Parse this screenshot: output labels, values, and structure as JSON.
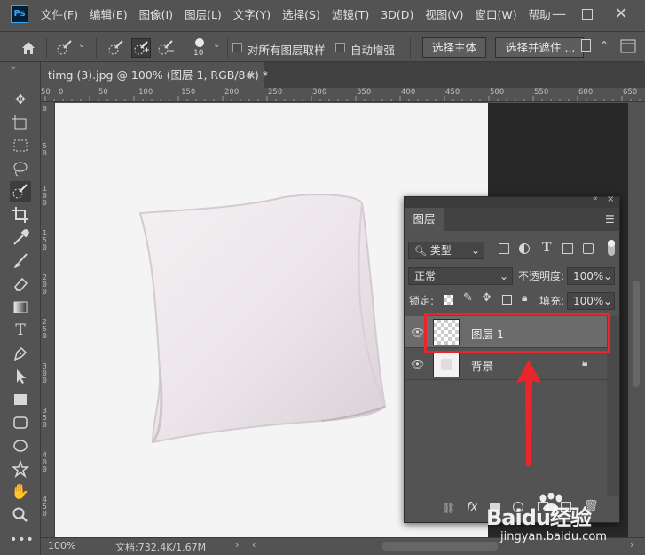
{
  "app": {
    "logo": "Ps"
  },
  "menu": [
    "文件(F)",
    "编辑(E)",
    "图像(I)",
    "图层(L)",
    "文字(Y)",
    "选择(S)",
    "滤镜(T)",
    "3D(D)",
    "视图(V)",
    "窗口(W)",
    "帮助"
  ],
  "options_bar": {
    "brush_size": "10",
    "sample_all_layers_label": "对所有图层取样",
    "auto_enhance_label": "自动增强",
    "select_subject_label": "选择主体",
    "select_and_mask_label": "选择并遮住 ..."
  },
  "document": {
    "tab_title": "timg (3).jpg @ 100% (图层 1, RGB/8#) *"
  },
  "ruler_top": [
    "50",
    "0",
    "50",
    "100",
    "150",
    "200",
    "250",
    "300",
    "350",
    "400",
    "450",
    "500",
    "550",
    "600",
    "650"
  ],
  "ruler_left": [
    "0",
    "5\n0",
    "1\n0\n0",
    "1\n5\n0",
    "2\n0\n0",
    "2\n5\n0",
    "3\n0\n0",
    "3\n5\n0",
    "4\n0\n0",
    "4\n5\n0"
  ],
  "status": {
    "zoom": "100%",
    "doc_size": "文档:732.4K/1.67M"
  },
  "layers_panel": {
    "tab": "图层",
    "filter_kind": "类型",
    "blend_mode": "正常",
    "opacity_label": "不透明度:",
    "opacity_value": "100%",
    "lock_label": "锁定:",
    "fill_label": "填充:",
    "fill_value": "100%",
    "layers": [
      {
        "name": "图层 1",
        "selected": true
      },
      {
        "name": "背景",
        "selected": false,
        "locked": true
      }
    ]
  },
  "watermark": {
    "brand": "Baidu经验",
    "url": "jingyan.baidu.com"
  },
  "colors": {
    "highlight_box": "#e8262b",
    "arrow": "#e8262b"
  }
}
